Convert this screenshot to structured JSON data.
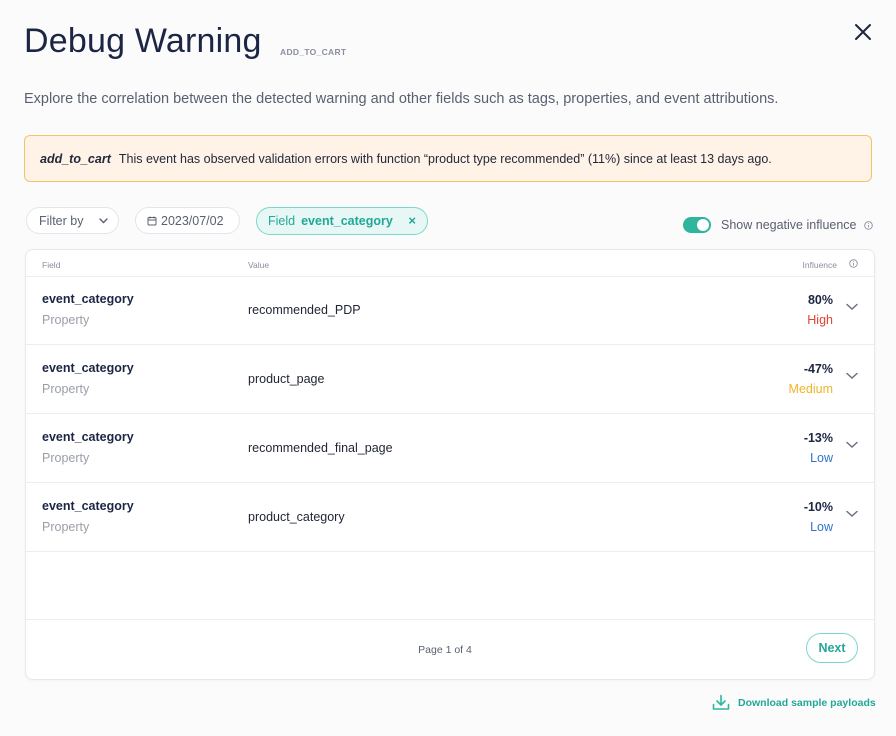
{
  "header": {
    "title": "Debug Warning",
    "event_code": "ADD_TO_CART",
    "subtitle": "Explore the correlation between the detected warning and other fields such as tags, properties, and event attributions."
  },
  "alert": {
    "event": "add_to_cart",
    "message": "This event has observed validation errors with function “product type recommended” (11%) since at least 13 days ago."
  },
  "filters": {
    "filter_by_label": "Filter by",
    "date": "2023/07/02",
    "chip_key": "Field",
    "chip_value": "event_category",
    "chip_remove": "×",
    "toggle_label": "Show negative influence",
    "toggle_on": true
  },
  "table": {
    "columns": {
      "field": "Field",
      "value": "Value",
      "influence": "Influence"
    },
    "rows": [
      {
        "field": "event_category",
        "type": "Property",
        "value": "recommended_PDP",
        "influence": "80%",
        "level": "High",
        "level_color": "#e0442e"
      },
      {
        "field": "event_category",
        "type": "Property",
        "value": "product_page",
        "influence": "-47%",
        "level": "Medium",
        "level_color": "#f0b429"
      },
      {
        "field": "event_category",
        "type": "Property",
        "value": "recommended_final_page",
        "influence": "-13%",
        "level": "Low",
        "level_color": "#2f73c9"
      },
      {
        "field": "event_category",
        "type": "Property",
        "value": "product_category",
        "influence": "-10%",
        "level": "Low",
        "level_color": "#2f73c9"
      }
    ],
    "pagination": {
      "text": "Page 1 of 4",
      "next_label": "Next"
    }
  },
  "footer": {
    "download_label": "Download sample payloads"
  },
  "colors": {
    "accent": "#2fb59c",
    "title": "#1c2544",
    "alert_bg": "#fff3e7",
    "alert_border": "#f2c46a"
  }
}
